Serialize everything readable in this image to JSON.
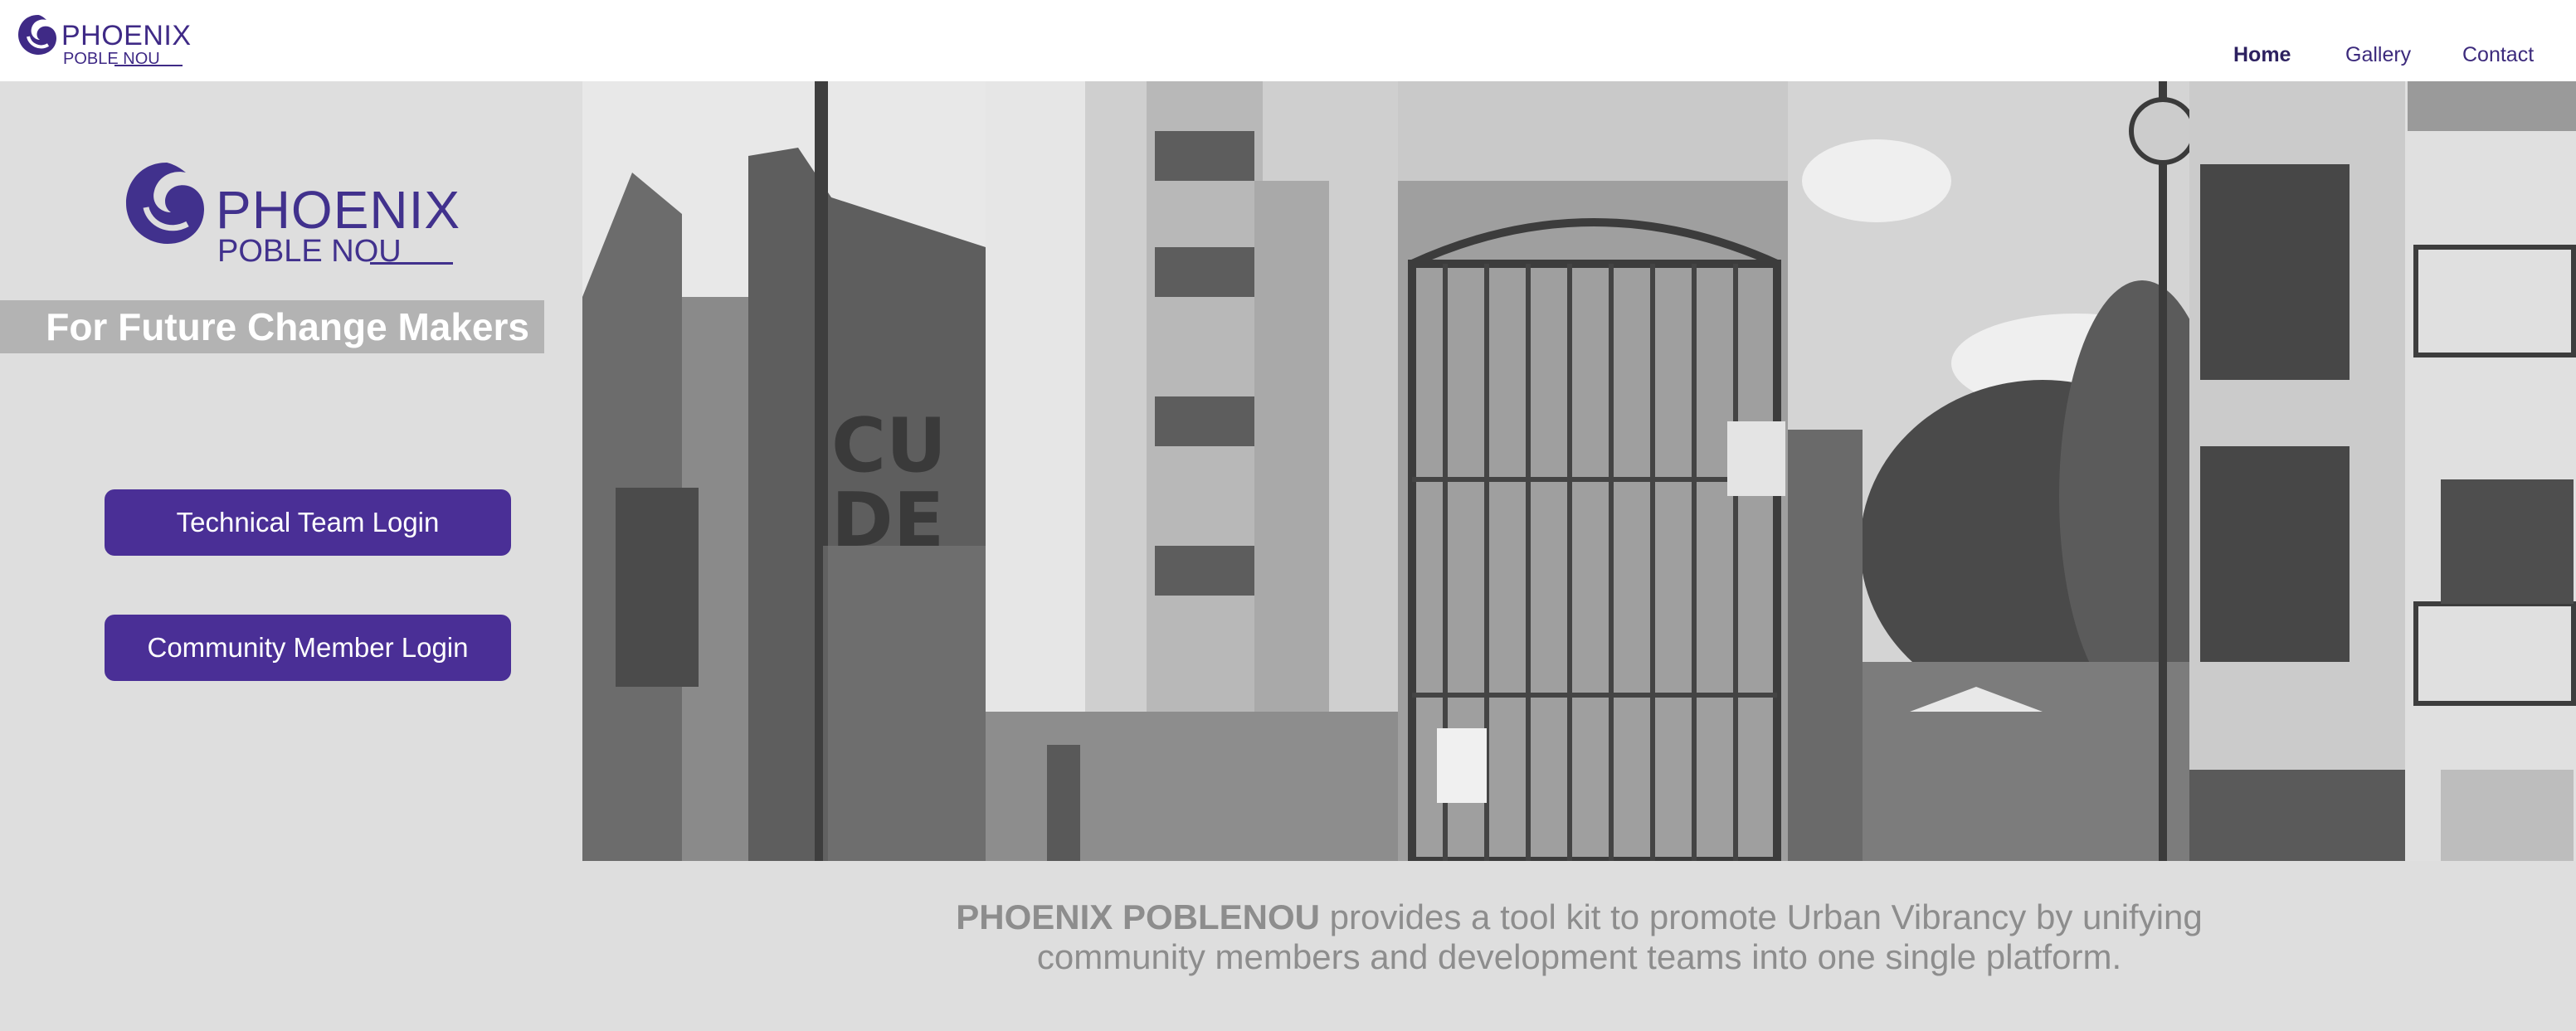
{
  "header": {
    "logo": {
      "line1": "PHOENIX",
      "line2": "POBLE NOU"
    },
    "nav": [
      {
        "label": "Home",
        "active": true
      },
      {
        "label": "Gallery",
        "active": false
      },
      {
        "label": "Contact",
        "active": false
      }
    ]
  },
  "hero_logo": {
    "line1": "PHOENIX",
    "line2": "POBLE NOU"
  },
  "tagline": "For Future Change Makers",
  "buttons": {
    "technical": "Technical Team Login",
    "community": "Community Member Login"
  },
  "description": {
    "brand": "PHOENIX POBLENOU",
    "line1_rest": " provides a tool kit to promote Urban Vibrancy by unifying",
    "line2": "community members and development teams into one single platform."
  },
  "colors": {
    "brand_purple": "#4a2f96",
    "page_bg": "#dedede",
    "tagline_bg": "#b3b3b3"
  },
  "icons": [
    "phoenix-swirl-logo-icon"
  ]
}
